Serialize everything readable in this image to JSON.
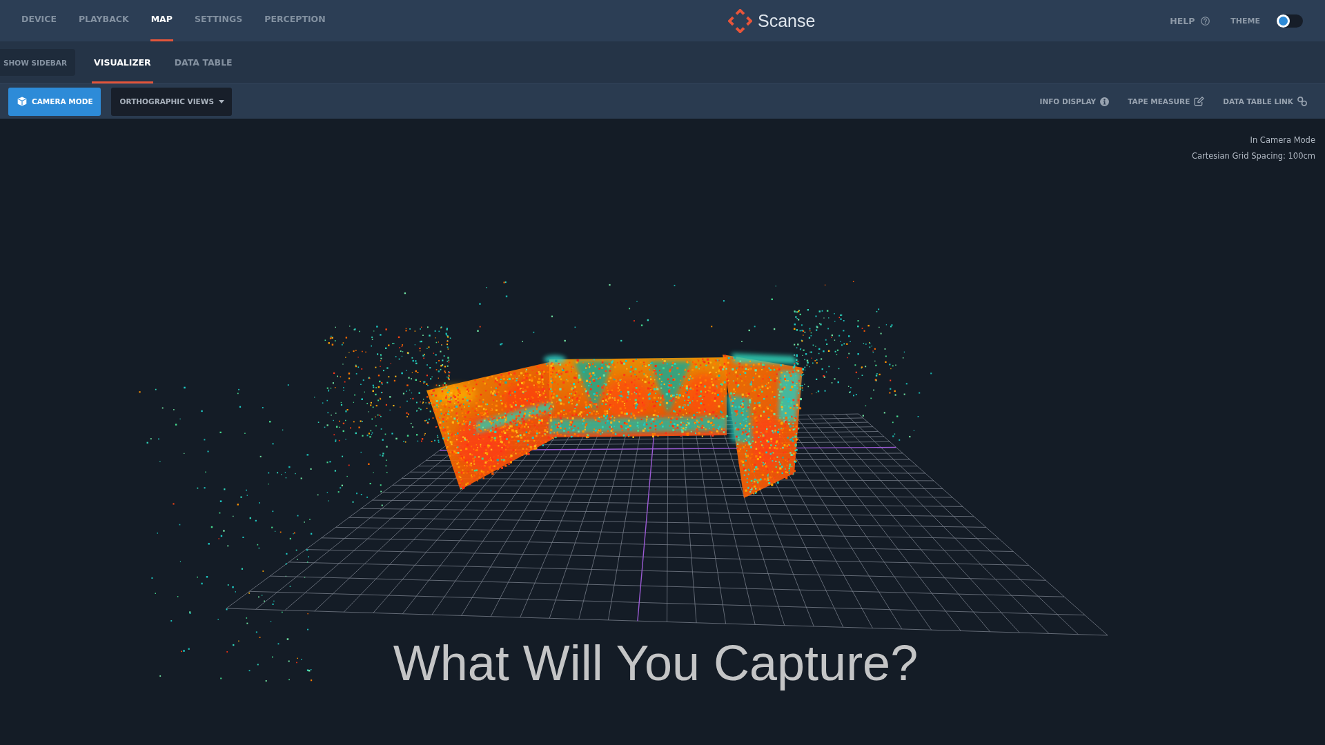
{
  "top_nav": {
    "items": [
      {
        "label": "DEVICE",
        "selected": false
      },
      {
        "label": "PLAYBACK",
        "selected": false
      },
      {
        "label": "MAP",
        "selected": true
      },
      {
        "label": "SETTINGS",
        "selected": false
      },
      {
        "label": "PERCEPTION",
        "selected": false
      }
    ],
    "brand": "Scanse",
    "help": "HELP",
    "theme": {
      "label": "THEME",
      "on": false
    }
  },
  "sub_nav": {
    "sidebar_button": "SHOW SIDEBAR",
    "tabs": [
      {
        "label": "VISUALIZER",
        "selected": true
      },
      {
        "label": "DATA TABLE",
        "selected": false
      }
    ]
  },
  "toolbar": {
    "view_modes": [
      {
        "kind": "camera",
        "label": "CAMERA MODE",
        "selected": true
      },
      {
        "kind": "dropdown",
        "label": "ORTHOGRAPHIC VIEWS",
        "selected": false
      }
    ],
    "tools": [
      {
        "kind": "info",
        "label": "INFO DISPLAY"
      },
      {
        "kind": "measure",
        "label": "TAPE MEASURE"
      },
      {
        "kind": "link",
        "label": "DATA TABLE LINK"
      }
    ]
  },
  "viewport": {
    "status_lines": [
      "In Camera Mode",
      "Cartesian Grid Spacing: 100cm"
    ],
    "headline": "What Will You Capture?"
  }
}
